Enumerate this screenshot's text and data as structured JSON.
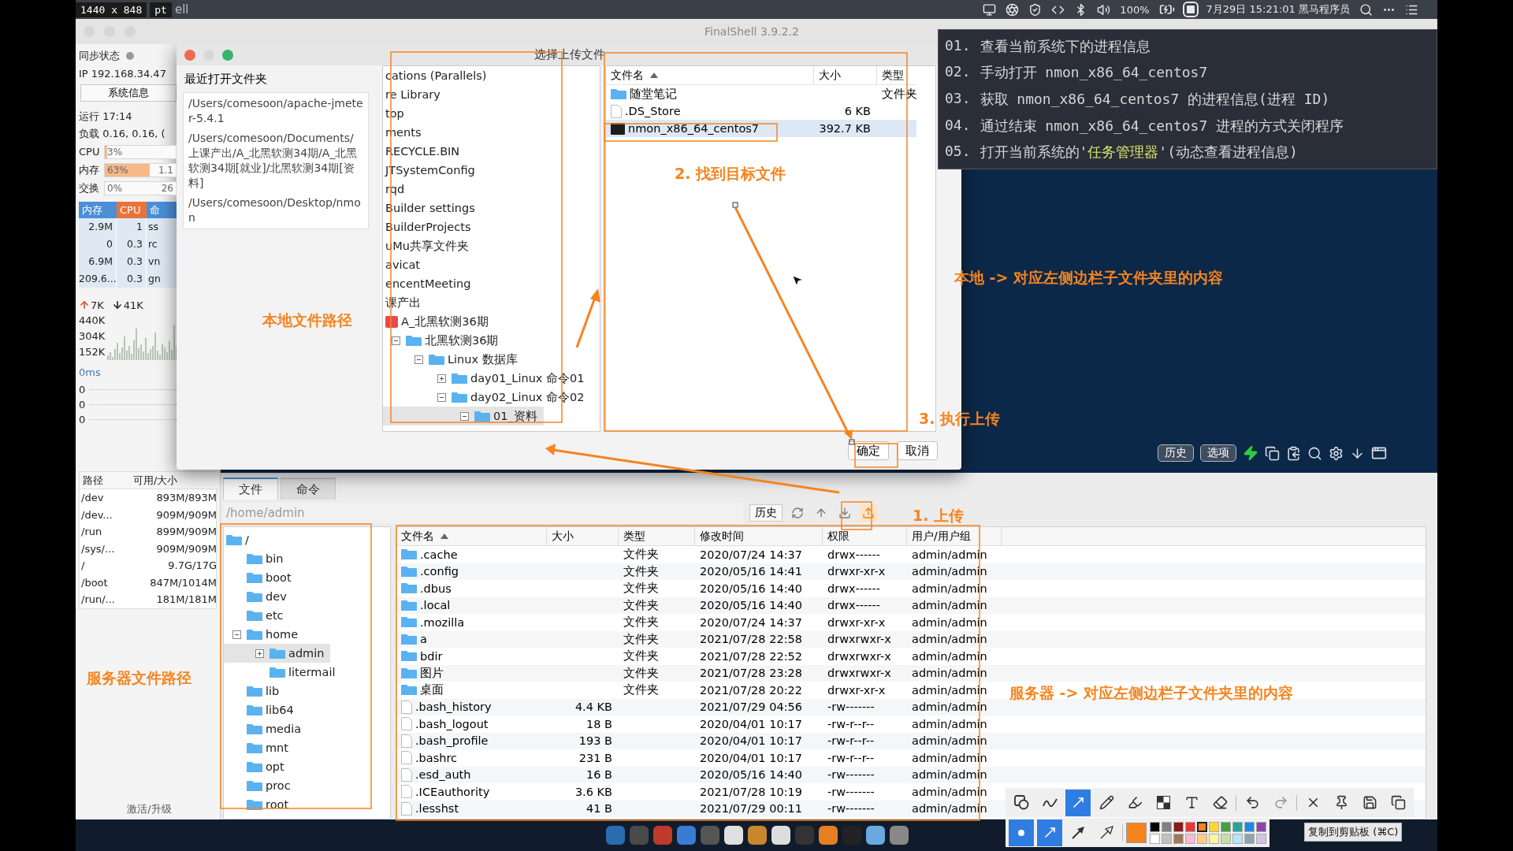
{
  "capture": {
    "size": "1440 x 848",
    "unit": "pt",
    "app_fragment": "ell"
  },
  "menubar": {
    "battery": "100%",
    "clock": "7月29日 15:21:01 黑马程序员"
  },
  "window": {
    "title": "FinalShell 3.9.2.2"
  },
  "sidebar": {
    "sync_label": "同步状态",
    "ip": "IP 192.168.34.47",
    "sysinfo_button": "系统信息",
    "uptime": "运行 17:14",
    "load": "负载 0.16, 0.16, (",
    "meters": [
      {
        "label": "CPU",
        "value": "3%",
        "level": 0.03
      },
      {
        "label": "内存",
        "value": "63%",
        "extra": "1.1",
        "level": 0.63
      },
      {
        "label": "交换",
        "value": "0%",
        "extra": "26"
      }
    ],
    "process_columns": [
      {
        "label": "内存",
        "sorted": false
      },
      {
        "label": "CPU",
        "sorted": true
      },
      {
        "label": "命",
        "sorted": false
      }
    ],
    "process_rows": [
      [
        "2.9M",
        "1",
        "ss"
      ],
      [
        "0",
        "0.3",
        "rc"
      ],
      [
        "6.9M",
        "0.3",
        "vn"
      ],
      [
        "209.6...",
        "0.3",
        "gn"
      ]
    ],
    "traffic": {
      "up": "7K",
      "down": "41K",
      "ticks": [
        "440K",
        "304K",
        "152K"
      ]
    },
    "latency": {
      "label": "0ms",
      "values": [
        "0",
        "0",
        "0"
      ]
    },
    "disk_columns": [
      "路径",
      "可用/大小"
    ],
    "disks": [
      {
        "path": "/dev",
        "usage": "893M/893M"
      },
      {
        "path": "/dev...",
        "usage": "909M/909M"
      },
      {
        "path": "/run",
        "usage": "899M/909M"
      },
      {
        "path": "/sys/...",
        "usage": "909M/909M"
      },
      {
        "path": "/",
        "usage": "9.7G/17G"
      },
      {
        "path": "/boot",
        "usage": "847M/1014M"
      },
      {
        "path": "/run/...",
        "usage": "181M/181M"
      }
    ],
    "activate_link": "激活/升级"
  },
  "dialog": {
    "title": "选择上传文件",
    "recent_label": "最近打开文件夹",
    "recent_paths": [
      "/Users/comesoon/apache-jmeter-5.4.1",
      "/Users/comesoon/Documents/上课产出/A_北黑软测34期/A_北黑软测34期[就业]/北黑软测34期[资料]",
      "/Users/comesoon/Desktop/nmon"
    ],
    "tree": [
      {
        "label": "cations (Parallels)",
        "kind": "text",
        "selected": false
      },
      {
        "label": "re Library",
        "kind": "text",
        "selected": false
      },
      {
        "label": "top",
        "kind": "text",
        "selected": false
      },
      {
        "label": "ments",
        "kind": "text",
        "selected": false
      },
      {
        "label": "RECYCLE.BIN",
        "kind": "text",
        "selected": false
      },
      {
        "label": "JTSystemConfig",
        "kind": "text",
        "selected": false
      },
      {
        "label": "rqd",
        "kind": "text",
        "selected": false
      },
      {
        "label": "Builder settings",
        "kind": "text",
        "selected": false
      },
      {
        "label": "BuilderProjects",
        "kind": "text",
        "selected": false
      },
      {
        "label": "uMu共享文件夹",
        "kind": "text",
        "selected": false
      },
      {
        "label": "avicat",
        "kind": "text",
        "selected": false
      },
      {
        "label": "encentMeeting",
        "kind": "text",
        "selected": false
      },
      {
        "label": "课产出",
        "kind": "text",
        "selected": false
      },
      {
        "label": "A_北黑软测36期",
        "kind": "marked",
        "selected": false,
        "children": [
          {
            "label": "北黑软测36期",
            "kind": "folder",
            "selected": false,
            "expanded": true,
            "children": [
              {
                "label": "Linux 数据库",
                "kind": "folder",
                "selected": false,
                "expanded": true,
                "children": [
                  {
                    "label": "day01_Linux 命令01",
                    "kind": "folder",
                    "selected": false,
                    "expanded": false
                  },
                  {
                    "label": "day02_Linux 命令02",
                    "kind": "folder",
                    "selected": false,
                    "expanded": true,
                    "children": [
                      {
                        "label": "01_资料",
                        "kind": "folder",
                        "selected": true,
                        "expanded": true
                      }
                    ]
                  }
                ]
              }
            ]
          }
        ]
      }
    ],
    "file_columns": [
      {
        "label": "文件名",
        "sorted": true
      },
      {
        "label": "大小",
        "sorted": false
      },
      {
        "label": "类型",
        "sorted": false
      }
    ],
    "files": [
      {
        "kind": "folder",
        "name": "随堂笔记",
        "type": "文件夹",
        "selected": false
      },
      {
        "kind": "file",
        "name": ".DS_Store",
        "size": "6 KB",
        "selected": false
      },
      {
        "kind": "program",
        "name": "nmon_x86_64_centos7",
        "size": "392.7 KB",
        "selected": true
      }
    ],
    "buttons": [
      "确定",
      "取消"
    ]
  },
  "notes": [
    {
      "number": "01.",
      "parts": [
        {
          "text": "查看当前系统下的进程信息",
          "highlight": false
        }
      ]
    },
    {
      "number": "02.",
      "parts": [
        {
          "text": "手动打开 nmon_x86_64_centos7",
          "highlight": false
        }
      ]
    },
    {
      "number": "03.",
      "parts": [
        {
          "text": "获取 nmon_x86_64_centos7 的进程信息(进程 ID)",
          "highlight": false
        }
      ]
    },
    {
      "number": "04.",
      "parts": [
        {
          "text": "通过结束 nmon_x86_64_centos7 进程的方式关闭程序",
          "highlight": false
        }
      ]
    },
    {
      "number": "05.",
      "parts": [
        {
          "text": "打开当前系统的'",
          "highlight": false
        },
        {
          "text": "任务管理器",
          "highlight": true
        },
        {
          "text": "'(动态查看进程信息)",
          "highlight": false
        }
      ]
    }
  ],
  "terminal_toolbar": {
    "buttons": [
      "历史",
      "选项"
    ]
  },
  "file_manager": {
    "tabs": [
      {
        "label": "文件",
        "selected": true
      },
      {
        "label": "命令",
        "selected": false
      }
    ],
    "path": "/home/admin",
    "history_button": "历史",
    "tree": [
      {
        "label": "/",
        "kind": "folder",
        "selected": false,
        "children": [
          {
            "label": "bin",
            "kind": "folder",
            "selected": false
          },
          {
            "label": "boot",
            "kind": "folder",
            "selected": false
          },
          {
            "label": "dev",
            "kind": "folder",
            "selected": false
          },
          {
            "label": "etc",
            "kind": "folder",
            "selected": false
          },
          {
            "label": "home",
            "kind": "folder",
            "selected": false,
            "expanded": true,
            "children": [
              {
                "label": "admin",
                "kind": "folder",
                "selected": true,
                "expanded": false
              },
              {
                "label": "litermail",
                "kind": "folder",
                "selected": false
              }
            ]
          },
          {
            "label": "lib",
            "kind": "folder",
            "selected": false
          },
          {
            "label": "lib64",
            "kind": "folder",
            "selected": false
          },
          {
            "label": "media",
            "kind": "folder",
            "selected": false
          },
          {
            "label": "mnt",
            "kind": "folder",
            "selected": false
          },
          {
            "label": "opt",
            "kind": "folder",
            "selected": false
          },
          {
            "label": "proc",
            "kind": "folder",
            "selected": false
          },
          {
            "label": "root",
            "kind": "folder",
            "selected": false
          }
        ]
      }
    ],
    "columns": [
      {
        "label": "文件名",
        "sorted": true
      },
      {
        "label": "大小",
        "sorted": false
      },
      {
        "label": "类型",
        "sorted": false
      },
      {
        "label": "修改时间",
        "sorted": false
      },
      {
        "label": "权限",
        "sorted": false
      },
      {
        "label": "用户/用户组",
        "sorted": false
      }
    ],
    "rows": [
      {
        "kind": "folder",
        "name": ".cache",
        "type": "文件夹",
        "modified": "2020/07/24 14:37",
        "permissions": "drwx------",
        "owner": "admin/admin"
      },
      {
        "kind": "folder",
        "name": ".config",
        "type": "文件夹",
        "modified": "2020/05/16 14:41",
        "permissions": "drwxr-xr-x",
        "owner": "admin/admin"
      },
      {
        "kind": "folder",
        "name": ".dbus",
        "type": "文件夹",
        "modified": "2020/05/16 14:40",
        "permissions": "drwx------",
        "owner": "admin/admin"
      },
      {
        "kind": "folder",
        "name": ".local",
        "type": "文件夹",
        "modified": "2020/05/16 14:40",
        "permissions": "drwx------",
        "owner": "admin/admin"
      },
      {
        "kind": "folder",
        "name": ".mozilla",
        "type": "文件夹",
        "modified": "2020/07/24 14:37",
        "permissions": "drwxr-xr-x",
        "owner": "admin/admin"
      },
      {
        "kind": "folder",
        "name": "a",
        "type": "文件夹",
        "modified": "2021/07/28 22:58",
        "permissions": "drwxrwxr-x",
        "owner": "admin/admin"
      },
      {
        "kind": "folder",
        "name": "bdir",
        "type": "文件夹",
        "modified": "2021/07/28 22:52",
        "permissions": "drwxrwxr-x",
        "owner": "admin/admin"
      },
      {
        "kind": "folder",
        "name": "图片",
        "type": "文件夹",
        "modified": "2021/07/28 23:28",
        "permissions": "drwxrwxr-x",
        "owner": "admin/admin"
      },
      {
        "kind": "folder",
        "name": "桌面",
        "type": "文件夹",
        "modified": "2021/07/28 20:22",
        "permissions": "drwxr-xr-x",
        "owner": "admin/admin"
      },
      {
        "kind": "file",
        "name": ".bash_history",
        "size": "4.4 KB",
        "modified": "2021/07/29 04:56",
        "permissions": "-rw-------",
        "owner": "admin/admin"
      },
      {
        "kind": "file",
        "name": ".bash_logout",
        "size": "18 B",
        "modified": "2020/04/01 10:17",
        "permissions": "-rw-r--r--",
        "owner": "admin/admin"
      },
      {
        "kind": "file",
        "name": ".bash_profile",
        "size": "193 B",
        "modified": "2020/04/01 10:17",
        "permissions": "-rw-r--r--",
        "owner": "admin/admin"
      },
      {
        "kind": "file",
        "name": ".bashrc",
        "size": "231 B",
        "modified": "2020/04/01 10:17",
        "permissions": "-rw-r--r--",
        "owner": "admin/admin"
      },
      {
        "kind": "file",
        "name": ".esd_auth",
        "size": "16 B",
        "modified": "2020/05/16 14:40",
        "permissions": "-rw-------",
        "owner": "admin/admin"
      },
      {
        "kind": "file",
        "name": ".ICEauthority",
        "size": "3.6 KB",
        "modified": "2021/07/28 10:19",
        "permissions": "-rw-------",
        "owner": "admin/admin"
      },
      {
        "kind": "file",
        "name": ".lesshst",
        "size": "41 B",
        "modified": "2021/07/29 00:11",
        "permissions": "-rw-------",
        "owner": "admin/admin"
      }
    ]
  },
  "annotations": [
    "本地文件路径",
    "2. 找到目标文件",
    "3. 执行上传",
    "1. 上传",
    "服务器文件路径",
    "本地 -> 对应左侧边栏子文件夹里的内容",
    "服务器 -> 对应左侧边栏子文件夹里的内容"
  ],
  "annotation_toolbar": {
    "tools": [
      {
        "kind": "shape",
        "selected": false
      },
      {
        "kind": "curve",
        "selected": false
      },
      {
        "kind": "arrow",
        "selected": true
      },
      {
        "kind": "pencil",
        "selected": false
      },
      {
        "kind": "marker",
        "selected": false
      },
      {
        "kind": "mosaic",
        "selected": false
      },
      {
        "kind": "text",
        "selected": false
      },
      {
        "kind": "eraser",
        "selected": false
      },
      {
        "kind": "undo",
        "selected": false
      },
      {
        "kind": "redo",
        "selected": false
      },
      {
        "kind": "close",
        "selected": false
      },
      {
        "kind": "pin",
        "selected": false
      },
      {
        "kind": "save",
        "selected": false
      },
      {
        "kind": "copy",
        "selected": false
      }
    ],
    "styles": [
      {
        "kind": "dot",
        "selected": true
      },
      {
        "kind": "arrow",
        "selected": true
      },
      {
        "kind": "solid-arrow",
        "selected": false
      },
      {
        "kind": "outline-arrow",
        "selected": false
      }
    ],
    "palette": [
      {
        "color": "#000000",
        "selected": false
      },
      {
        "color": "#808080",
        "selected": false
      },
      {
        "color": "#8b1a1a",
        "selected": false
      },
      {
        "color": "#e53935",
        "selected": false
      },
      {
        "color": "#f5841f",
        "selected": true
      },
      {
        "color": "#fdd835",
        "selected": false
      },
      {
        "color": "#43a047",
        "selected": false
      },
      {
        "color": "#26a69a",
        "selected": false
      },
      {
        "color": "#1e88e5",
        "selected": false
      },
      {
        "color": "#8e44ad",
        "selected": false
      },
      {
        "color": "#ffffff",
        "selected": false
      },
      {
        "color": "#c0c0c0",
        "selected": false
      },
      {
        "color": "#a0785a",
        "selected": false
      },
      {
        "color": "#f8bbd0",
        "selected": false
      },
      {
        "color": "#ffcc80",
        "selected": false
      },
      {
        "color": "#fff59d",
        "selected": false
      },
      {
        "color": "#c5e1a5",
        "selected": false
      },
      {
        "color": "#b3e5fc",
        "selected": false
      },
      {
        "color": "#90a4ae",
        "selected": false
      },
      {
        "color": "#d1c4e9",
        "selected": false
      }
    ],
    "tooltip": "复制到剪贴板 (⌘C)"
  }
}
